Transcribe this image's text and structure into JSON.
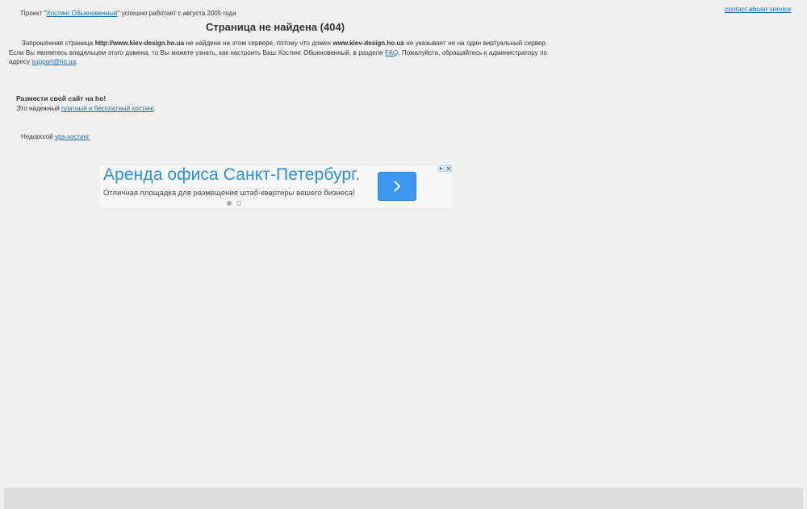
{
  "header": {
    "abuse_link": "contact abuse service",
    "project_prefix": "Проект \"",
    "project_link": "Хостинг Обыкновенный",
    "project_suffix": "\" успешно работает с августа 2005 года"
  },
  "error": {
    "title": "Страница не найдена (404)",
    "msg_1": "Запрошенная страница ",
    "url": "http://www.kiev-design.ho.ua",
    "msg_2": " не найдена на этом сервере, потому что домен ",
    "domain": "www.kiev-design.ho.ua",
    "msg_3": " не указывает ни на один виртуальный сервер. Если Вы являетесь владельцем этого домена, то Вы можете узнать, как настроить Ваш Хостинг Обыкновенный, в разделе ",
    "faq_link": "FAQ",
    "msg_4": ". Пожалуйста, обращайтесь к администратору по адресу ",
    "support_email": "support@ho.ua",
    "msg_5": "."
  },
  "promo": {
    "heading": "Размести свой сайт на ho!",
    "text_prefix": "Это надежный ",
    "hosting_link": "платный и бесплатный хостинг",
    "text_suffix": "."
  },
  "vps": {
    "prefix": "Недорогой ",
    "link": "vps-хостинг"
  },
  "ad": {
    "headline": "Аренда офиса Санкт-Петербург.",
    "description": "Отличная площадка для размещения штаб-квартиры вашего бизнеса!",
    "arrow_icon": "chevron-right-icon",
    "accent_color": "#3d98f0",
    "headline_color": "#2f8fd8",
    "slides_total": 2,
    "slide_active": 1
  },
  "colors": {
    "background": "#f0f0f0",
    "link": "#1a6fb5",
    "footer_bar": "#dcdcdc"
  }
}
